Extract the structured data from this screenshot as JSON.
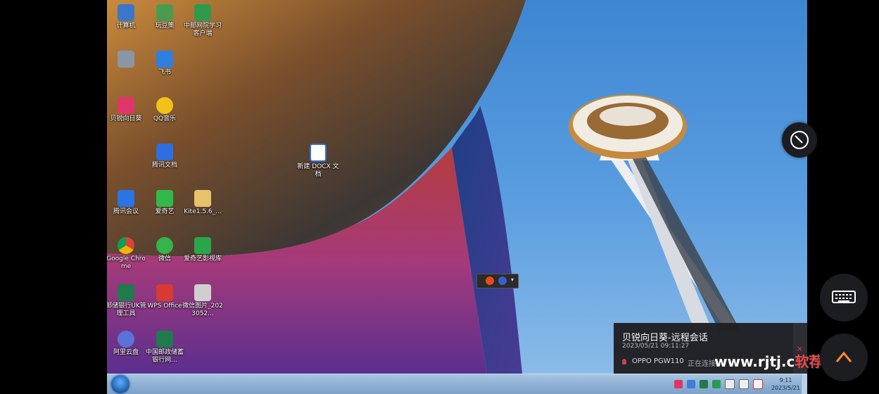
{
  "desktop_icons": [
    {
      "label": "计算机",
      "color": "#3b77c9"
    },
    {
      "label": "玩豆策",
      "color": "#4a9a52"
    },
    {
      "label": "中邮网院学习客户端",
      "color": "#2f9a4c"
    },
    {
      "label": "",
      "color": "#8a96a6"
    },
    {
      "label": "飞书",
      "color": "#2e7fe0"
    },
    {
      "label": "贝锐向日葵",
      "color": "#e0356b"
    },
    {
      "label": "QQ音乐",
      "color": "#f2c21b"
    },
    {
      "label": "腾讯文档",
      "color": "#2f6ee0"
    },
    {
      "label": "腾讯会议",
      "color": "#2a74e6"
    },
    {
      "label": "爱奇艺",
      "color": "#2fba4a"
    },
    {
      "label": "Kite1.5.6_...",
      "color": "#e6c36a"
    },
    {
      "label": "Google Chrome",
      "color": "#e2b229"
    },
    {
      "label": "微信",
      "color": "#36b34a"
    },
    {
      "label": "爱奇艺影视库",
      "color": "#29a64a"
    },
    {
      "label": "邮储银行UK管理工具",
      "color": "#1f7a4c"
    },
    {
      "label": "WPS Office",
      "color": "#d63a30"
    },
    {
      "label": "微信图片_2023052...",
      "color": "#cfcfcf"
    },
    {
      "label": "阿里云盘",
      "color": "#5a73d9"
    },
    {
      "label": "中国邮政储蓄银行网...",
      "color": "#1f7a4c"
    },
    {
      "label": "新建 DOCX 文档",
      "color": "#2f6fd4"
    }
  ],
  "taskbar": {
    "clock_time": "9:11",
    "clock_date": "2023/5/21"
  },
  "notification": {
    "title": "贝锐向日葵-远程会话",
    "time": "2023/05/21 09:11:27",
    "close": "×",
    "device": "OPPO PGW110",
    "status": "正在连接"
  },
  "watermark": {
    "part1": "www.rjtj.c",
    "part2": "软荐网"
  },
  "colors": {
    "taskbar": "#8fb1d3",
    "notification_bg": "#1f1f22",
    "side_button_bg": "#1c1d21"
  }
}
